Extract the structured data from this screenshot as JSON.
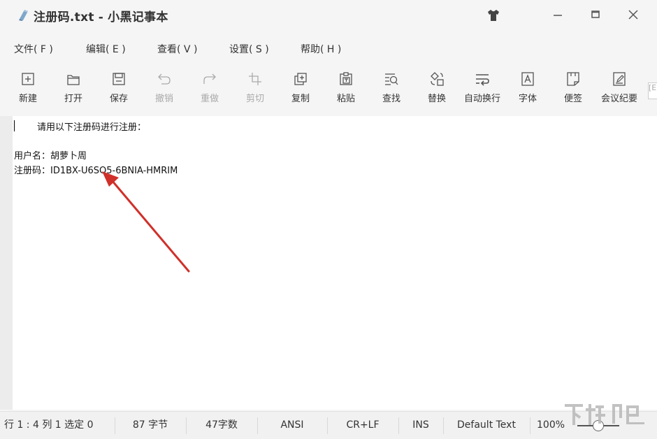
{
  "window": {
    "filename": "注册码.txt",
    "separator": "-",
    "app_name": "小黑记事本"
  },
  "menu": [
    {
      "label": "文件( F )"
    },
    {
      "label": "编辑( E )"
    },
    {
      "label": "查看( V )"
    },
    {
      "label": "设置( S )"
    },
    {
      "label": "帮助( H )"
    }
  ],
  "toolbar": [
    {
      "label": "新建",
      "icon": "new-file-icon",
      "enabled": true
    },
    {
      "label": "打开",
      "icon": "folder-open-icon",
      "enabled": true
    },
    {
      "label": "保存",
      "icon": "save-icon",
      "enabled": true
    },
    {
      "label": "撤销",
      "icon": "undo-icon",
      "enabled": false
    },
    {
      "label": "重做",
      "icon": "redo-icon",
      "enabled": false
    },
    {
      "label": "剪切",
      "icon": "crop-cut-icon",
      "enabled": false
    },
    {
      "label": "复制",
      "icon": "copy-icon",
      "enabled": true
    },
    {
      "label": "粘贴",
      "icon": "paste-icon",
      "enabled": true
    },
    {
      "label": "查找",
      "icon": "find-icon",
      "enabled": true
    },
    {
      "label": "替换",
      "icon": "replace-icon",
      "enabled": true
    },
    {
      "label": "自动换行",
      "icon": "word-wrap-icon",
      "enabled": true
    },
    {
      "label": "字体",
      "icon": "font-icon",
      "enabled": true
    },
    {
      "label": "便签",
      "icon": "sticky-note-icon",
      "enabled": true
    },
    {
      "label": "会议纪要",
      "icon": "meeting-notes-icon",
      "enabled": true
    }
  ],
  "toolbar_overflow": "[E",
  "document": {
    "lines": [
      "        请用以下注册码进行注册：",
      "",
      "用户名：胡萝卜周",
      "注册码：ID1BX-U6SQ5-6BNIA-HMRIM"
    ]
  },
  "status": {
    "position": "行 1 : 4   列 1   选定 0",
    "bytes": "87 字节",
    "chars": "47字数",
    "encoding": "ANSI",
    "line_ending": "CR+LF",
    "insert_mode": "INS",
    "syntax": "Default Text",
    "zoom": "100%",
    "zoom_level": 1.0
  },
  "colors": {
    "annotation_arrow": "#d0302a",
    "title_bar": "#f5f5f5",
    "editor_bg": "#ffffff"
  }
}
